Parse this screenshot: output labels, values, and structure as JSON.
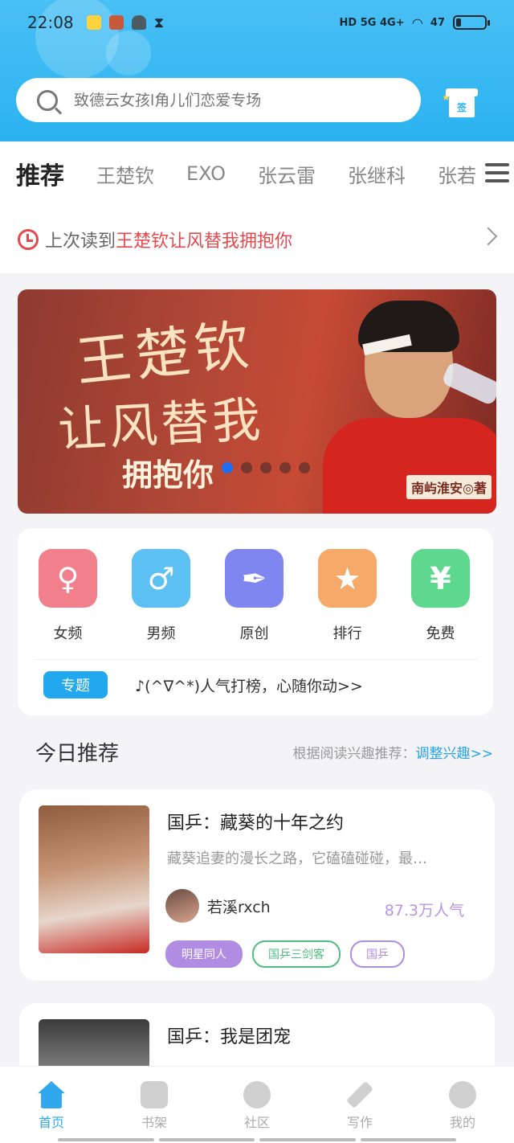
{
  "status": {
    "time": "22:08",
    "network": "HD 5G 4G+",
    "battery": "47"
  },
  "search": {
    "placeholder": "致德云女孩l角儿们恋爱专场"
  },
  "sign_label": "签",
  "tabs": [
    "推荐",
    "王楚钦",
    "EXO",
    "张云雷",
    "张继科",
    "张若"
  ],
  "last_read": {
    "label": "上次读到",
    "title": "王楚钦让风替我拥抱你"
  },
  "banner": {
    "line1": "王楚钦",
    "line2": "让风替我",
    "line3": "拥抱你",
    "author": "南屿淮安◎著",
    "dots": 5,
    "active_dot": 0
  },
  "categories": [
    {
      "label": "女频",
      "icon": "female-icon",
      "glyph": "♀",
      "color": "#f17f8c"
    },
    {
      "label": "男频",
      "icon": "male-icon",
      "glyph": "♂",
      "color": "#5cc1f2"
    },
    {
      "label": "原创",
      "icon": "pen-nib-icon",
      "glyph": "✒",
      "color": "#7f86f0"
    },
    {
      "label": "排行",
      "icon": "podium-icon",
      "glyph": "★",
      "color": "#f7a96a"
    },
    {
      "label": "免费",
      "icon": "yen-icon",
      "glyph": "¥",
      "color": "#5fd88f"
    }
  ],
  "topic": {
    "tag": "专题",
    "text": "♪(^∇^*)人气打榜，心随你动>>"
  },
  "today": {
    "heading": "今日推荐",
    "hint": "根据阅读兴趣推荐：",
    "adjust": "调整兴趣>>"
  },
  "books": [
    {
      "title": "国乒：藏葵的十年之约",
      "desc": "藏葵追妻的漫长之路，它磕磕碰碰，最…",
      "author": "若溪rxch",
      "popularity": "87.3万人气",
      "tags": [
        {
          "text": "明星同人",
          "color": "#b18ce3",
          "filled": true
        },
        {
          "text": "国乒三剑客",
          "color": "#4ebf7f",
          "filled": false
        },
        {
          "text": "国乒",
          "color": "#b18ce3",
          "filled": false
        }
      ]
    },
    {
      "title": "国乒：我是团宠"
    }
  ],
  "nav": [
    "首页",
    "书架",
    "社区",
    "写作",
    "我的"
  ]
}
